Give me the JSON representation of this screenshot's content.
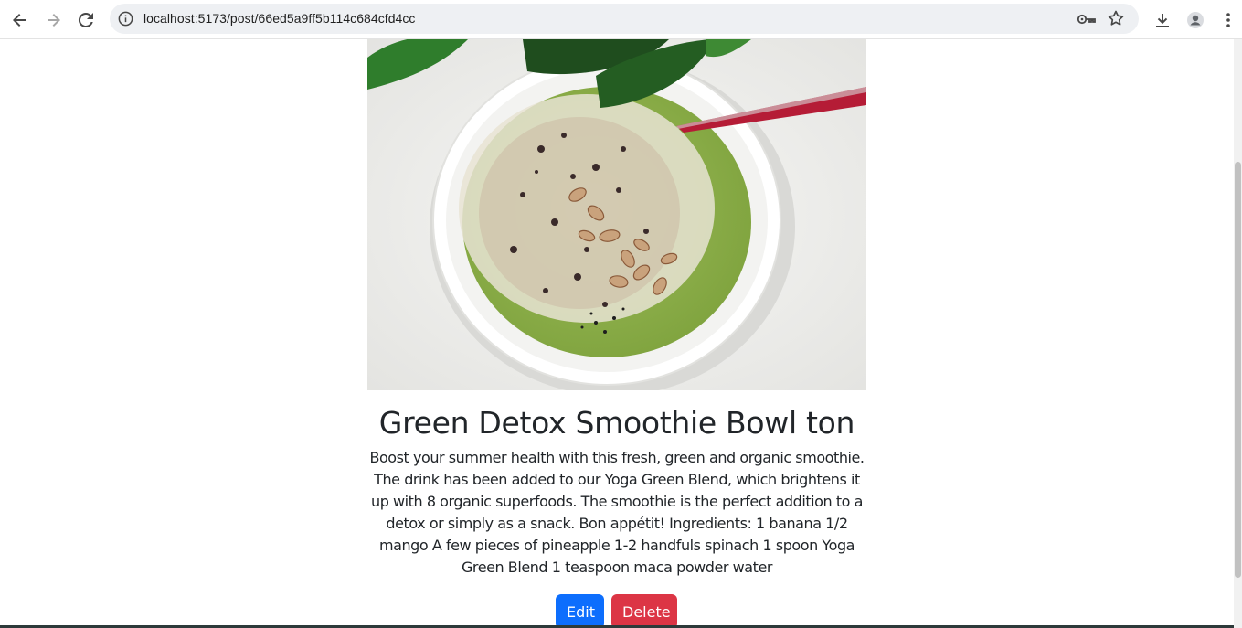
{
  "browser": {
    "url": "localhost:5173/post/66ed5a9ff5b114c684cfd4cc"
  },
  "post": {
    "title": "Green Detox Smoothie Bowl ton",
    "body": "Boost your summer health with this fresh, green and organic smoothie. The drink has been added to our Yoga Green Blend, which brightens it up with 8 organic superfoods. The smoothie is the perfect addition to a detox or simply as a snack. Bon appétit! Ingredients: 1 banana 1/2 mango A few pieces of pineapple 1-2 handfuls spinach 1 spoon Yoga Green Blend 1 teaspoon maca powder water",
    "edit_label": "Edit",
    "delete_label": "Delete"
  },
  "colors": {
    "edit_button": "#0d6efd",
    "delete_button": "#dc3545",
    "text": "#212529"
  },
  "icons": [
    "back-arrow-icon",
    "forward-arrow-icon",
    "reload-icon",
    "site-info-icon",
    "password-key-icon",
    "bookmark-star-icon",
    "download-icon",
    "profile-icon",
    "more-menu-icon"
  ]
}
